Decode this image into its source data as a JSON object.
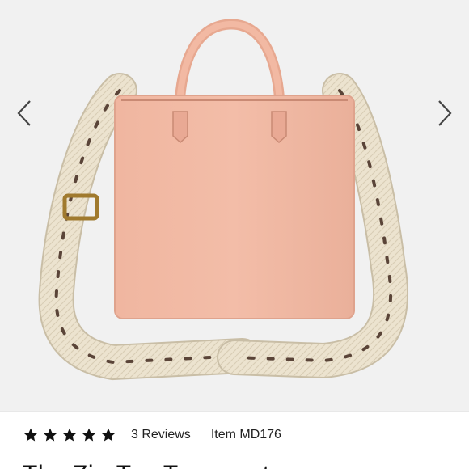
{
  "gallery": {
    "image_alt": "The Zip-Top Transport Crossbody in pink leather with woven strap",
    "prev_icon": "chevron-left-icon",
    "next_icon": "chevron-right-icon"
  },
  "rating": {
    "stars": 5,
    "max": 5,
    "icon": "star-icon",
    "reviews_label": "3 Reviews"
  },
  "item": {
    "code_label": "Item MD176"
  },
  "product": {
    "title": "The Zip-Top Transport"
  },
  "colors": {
    "bag": "#f1b9a2",
    "strap": "#ede4d0",
    "accent_dark": "#3a2a22"
  }
}
